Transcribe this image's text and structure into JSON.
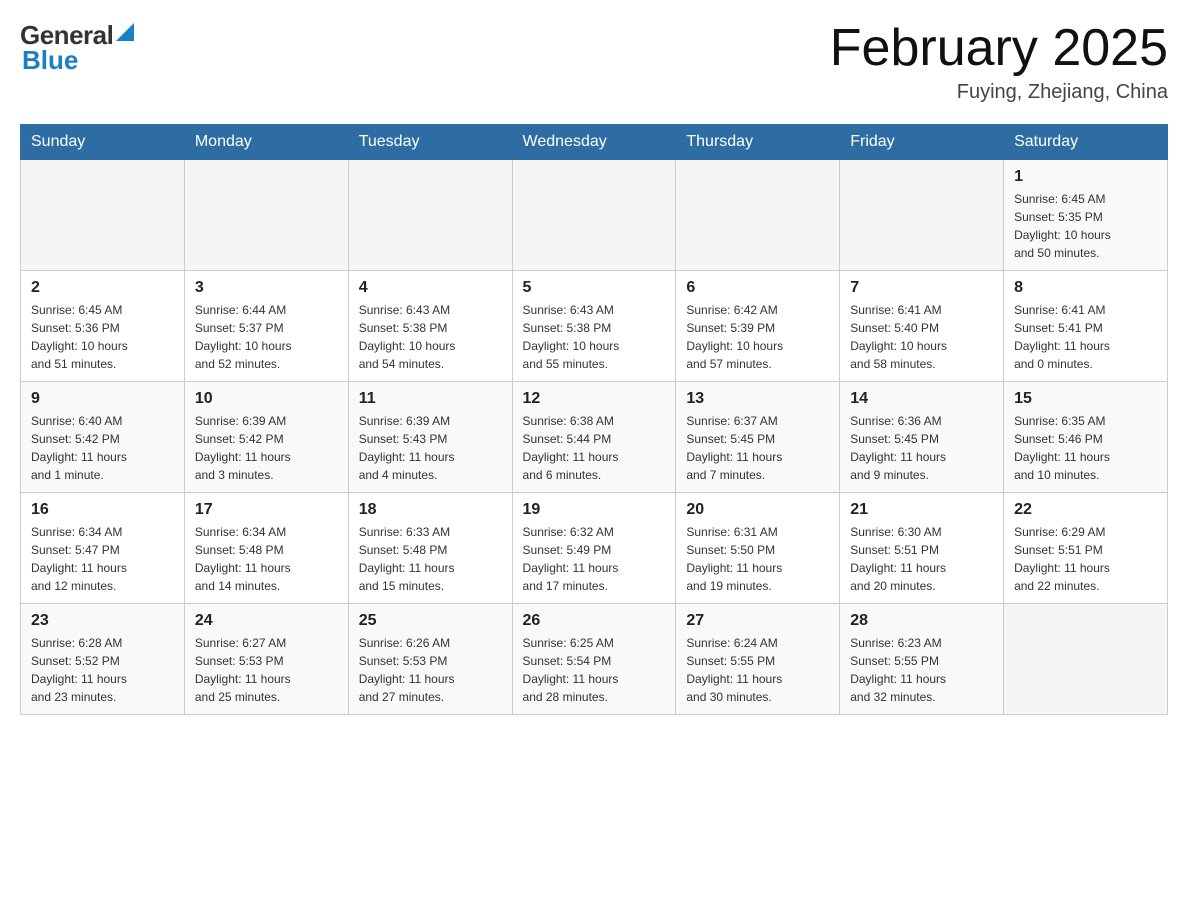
{
  "header": {
    "logo_general": "General",
    "logo_blue": "Blue",
    "month_title": "February 2025",
    "location": "Fuying, Zhejiang, China"
  },
  "weekdays": [
    "Sunday",
    "Monday",
    "Tuesday",
    "Wednesday",
    "Thursday",
    "Friday",
    "Saturday"
  ],
  "weeks": [
    [
      {
        "day": "",
        "info": ""
      },
      {
        "day": "",
        "info": ""
      },
      {
        "day": "",
        "info": ""
      },
      {
        "day": "",
        "info": ""
      },
      {
        "day": "",
        "info": ""
      },
      {
        "day": "",
        "info": ""
      },
      {
        "day": "1",
        "info": "Sunrise: 6:45 AM\nSunset: 5:35 PM\nDaylight: 10 hours\nand 50 minutes."
      }
    ],
    [
      {
        "day": "2",
        "info": "Sunrise: 6:45 AM\nSunset: 5:36 PM\nDaylight: 10 hours\nand 51 minutes."
      },
      {
        "day": "3",
        "info": "Sunrise: 6:44 AM\nSunset: 5:37 PM\nDaylight: 10 hours\nand 52 minutes."
      },
      {
        "day": "4",
        "info": "Sunrise: 6:43 AM\nSunset: 5:38 PM\nDaylight: 10 hours\nand 54 minutes."
      },
      {
        "day": "5",
        "info": "Sunrise: 6:43 AM\nSunset: 5:38 PM\nDaylight: 10 hours\nand 55 minutes."
      },
      {
        "day": "6",
        "info": "Sunrise: 6:42 AM\nSunset: 5:39 PM\nDaylight: 10 hours\nand 57 minutes."
      },
      {
        "day": "7",
        "info": "Sunrise: 6:41 AM\nSunset: 5:40 PM\nDaylight: 10 hours\nand 58 minutes."
      },
      {
        "day": "8",
        "info": "Sunrise: 6:41 AM\nSunset: 5:41 PM\nDaylight: 11 hours\nand 0 minutes."
      }
    ],
    [
      {
        "day": "9",
        "info": "Sunrise: 6:40 AM\nSunset: 5:42 PM\nDaylight: 11 hours\nand 1 minute."
      },
      {
        "day": "10",
        "info": "Sunrise: 6:39 AM\nSunset: 5:42 PM\nDaylight: 11 hours\nand 3 minutes."
      },
      {
        "day": "11",
        "info": "Sunrise: 6:39 AM\nSunset: 5:43 PM\nDaylight: 11 hours\nand 4 minutes."
      },
      {
        "day": "12",
        "info": "Sunrise: 6:38 AM\nSunset: 5:44 PM\nDaylight: 11 hours\nand 6 minutes."
      },
      {
        "day": "13",
        "info": "Sunrise: 6:37 AM\nSunset: 5:45 PM\nDaylight: 11 hours\nand 7 minutes."
      },
      {
        "day": "14",
        "info": "Sunrise: 6:36 AM\nSunset: 5:45 PM\nDaylight: 11 hours\nand 9 minutes."
      },
      {
        "day": "15",
        "info": "Sunrise: 6:35 AM\nSunset: 5:46 PM\nDaylight: 11 hours\nand 10 minutes."
      }
    ],
    [
      {
        "day": "16",
        "info": "Sunrise: 6:34 AM\nSunset: 5:47 PM\nDaylight: 11 hours\nand 12 minutes."
      },
      {
        "day": "17",
        "info": "Sunrise: 6:34 AM\nSunset: 5:48 PM\nDaylight: 11 hours\nand 14 minutes."
      },
      {
        "day": "18",
        "info": "Sunrise: 6:33 AM\nSunset: 5:48 PM\nDaylight: 11 hours\nand 15 minutes."
      },
      {
        "day": "19",
        "info": "Sunrise: 6:32 AM\nSunset: 5:49 PM\nDaylight: 11 hours\nand 17 minutes."
      },
      {
        "day": "20",
        "info": "Sunrise: 6:31 AM\nSunset: 5:50 PM\nDaylight: 11 hours\nand 19 minutes."
      },
      {
        "day": "21",
        "info": "Sunrise: 6:30 AM\nSunset: 5:51 PM\nDaylight: 11 hours\nand 20 minutes."
      },
      {
        "day": "22",
        "info": "Sunrise: 6:29 AM\nSunset: 5:51 PM\nDaylight: 11 hours\nand 22 minutes."
      }
    ],
    [
      {
        "day": "23",
        "info": "Sunrise: 6:28 AM\nSunset: 5:52 PM\nDaylight: 11 hours\nand 23 minutes."
      },
      {
        "day": "24",
        "info": "Sunrise: 6:27 AM\nSunset: 5:53 PM\nDaylight: 11 hours\nand 25 minutes."
      },
      {
        "day": "25",
        "info": "Sunrise: 6:26 AM\nSunset: 5:53 PM\nDaylight: 11 hours\nand 27 minutes."
      },
      {
        "day": "26",
        "info": "Sunrise: 6:25 AM\nSunset: 5:54 PM\nDaylight: 11 hours\nand 28 minutes."
      },
      {
        "day": "27",
        "info": "Sunrise: 6:24 AM\nSunset: 5:55 PM\nDaylight: 11 hours\nand 30 minutes."
      },
      {
        "day": "28",
        "info": "Sunrise: 6:23 AM\nSunset: 5:55 PM\nDaylight: 11 hours\nand 32 minutes."
      },
      {
        "day": "",
        "info": ""
      }
    ]
  ]
}
